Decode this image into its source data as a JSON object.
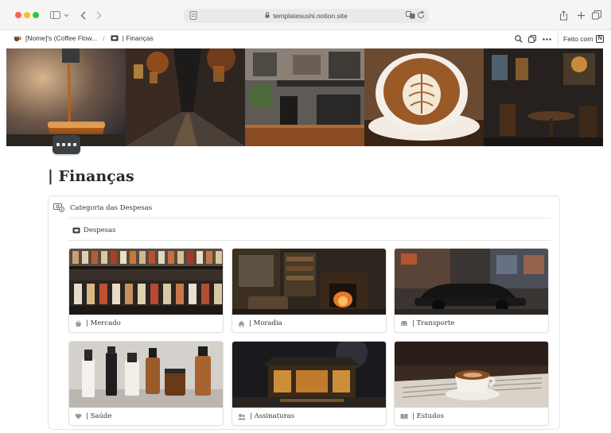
{
  "browser": {
    "url": "templatesushi.notion.site"
  },
  "topbar": {
    "breadcrumb_root": "[Nome]'s (Coffee Flow...",
    "breadcrumb_sep": "/",
    "breadcrumb_current": "| Finanças",
    "made_with": "Feito com"
  },
  "page": {
    "title": "| Finanças"
  },
  "callout": {
    "heading": "Categoria das Despesas",
    "view_tab": "Despesas"
  },
  "gallery": {
    "cards": [
      {
        "label": "| Mercado",
        "icon": "store-icon"
      },
      {
        "label": "| Moradia",
        "icon": "home-icon"
      },
      {
        "label": "| Transporte",
        "icon": "car-icon"
      },
      {
        "label": "| Saúde",
        "icon": "heart-icon"
      },
      {
        "label": "| Assinaturas",
        "icon": "subscription-icon"
      },
      {
        "label": "| Estudos",
        "icon": "book-icon"
      }
    ]
  }
}
